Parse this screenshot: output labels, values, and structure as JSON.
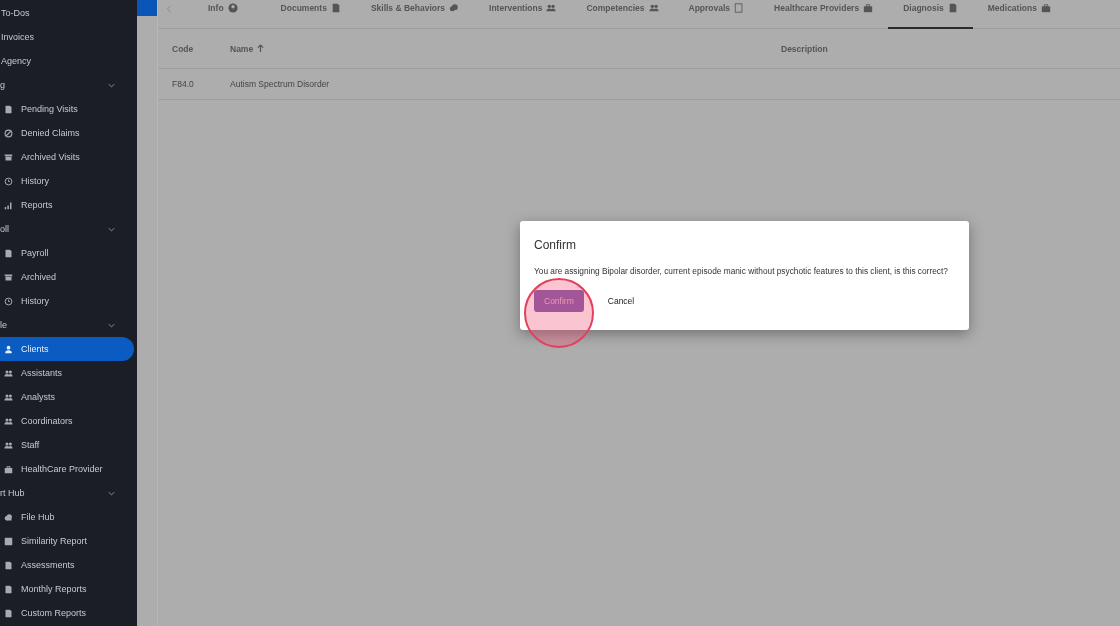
{
  "sidebar": {
    "items": [
      {
        "kind": "plain",
        "label": "To-Dos"
      },
      {
        "kind": "plain",
        "label": "Invoices"
      },
      {
        "kind": "plain",
        "label": "Agency"
      },
      {
        "kind": "header",
        "label": "g"
      },
      {
        "kind": "link",
        "label": "Pending Visits",
        "selected": false
      },
      {
        "kind": "link",
        "label": "Denied Claims",
        "selected": false
      },
      {
        "kind": "link",
        "label": "Archived Visits",
        "selected": false
      },
      {
        "kind": "link",
        "label": "History",
        "selected": false
      },
      {
        "kind": "link",
        "label": "Reports",
        "selected": false
      },
      {
        "kind": "header",
        "label": "oll"
      },
      {
        "kind": "link",
        "label": "Payroll",
        "selected": false
      },
      {
        "kind": "link",
        "label": "Archived",
        "selected": false
      },
      {
        "kind": "link",
        "label": "History",
        "selected": false
      },
      {
        "kind": "header",
        "label": "le"
      },
      {
        "kind": "link",
        "label": "Clients",
        "selected": true
      },
      {
        "kind": "link",
        "label": "Assistants",
        "selected": false
      },
      {
        "kind": "link",
        "label": "Analysts",
        "selected": false
      },
      {
        "kind": "link",
        "label": "Coordinators",
        "selected": false
      },
      {
        "kind": "link",
        "label": "Staff",
        "selected": false
      },
      {
        "kind": "link",
        "label": "HealthCare Provider",
        "selected": false
      },
      {
        "kind": "header",
        "label": "rt Hub"
      },
      {
        "kind": "link",
        "label": "File Hub",
        "selected": false
      },
      {
        "kind": "link",
        "label": "Similarity Report",
        "selected": false
      },
      {
        "kind": "link",
        "label": "Assessments",
        "selected": false
      },
      {
        "kind": "link",
        "label": "Monthly Reports",
        "selected": false
      },
      {
        "kind": "link",
        "label": "Custom Reports",
        "selected": false
      }
    ]
  },
  "tabs": [
    {
      "label": "Info",
      "selected": false
    },
    {
      "label": "Documents",
      "selected": false
    },
    {
      "label": "Skills & Behaviors",
      "selected": false
    },
    {
      "label": "Interventions",
      "selected": false
    },
    {
      "label": "Competencies",
      "selected": false
    },
    {
      "label": "Approvals",
      "selected": false
    },
    {
      "label": "Healthcare Providers",
      "selected": false
    },
    {
      "label": "Diagnosis",
      "selected": true
    },
    {
      "label": "Medications",
      "selected": false
    }
  ],
  "table": {
    "columns": [
      "Code",
      "Name",
      "Description"
    ],
    "rows": [
      [
        "F84.0",
        "Autism Spectrum Disorder"
      ]
    ]
  },
  "dialog": {
    "title": "Confirm",
    "message": "You are assigning Bipolar disorder, current episode manic without psychotic features to this client, is this correct?",
    "confirm": "Confirm",
    "cancel": "Cancel"
  }
}
